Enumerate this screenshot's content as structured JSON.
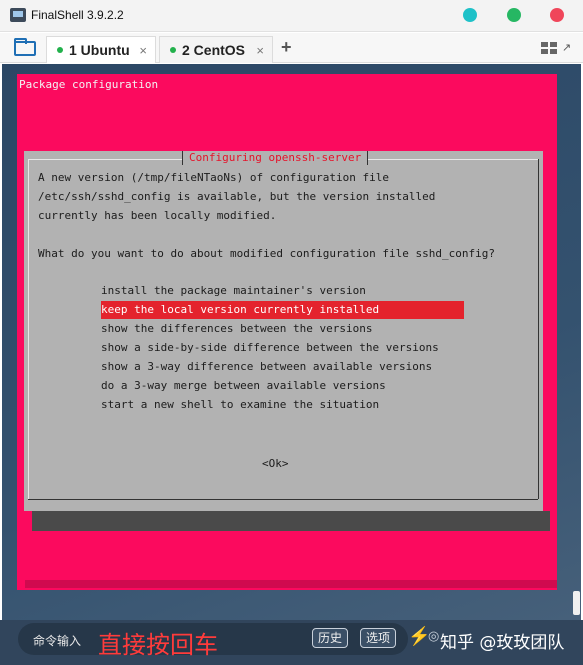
{
  "window": {
    "title": "FinalShell 3.9.2.2"
  },
  "tabs": [
    {
      "label": "1 Ubuntu",
      "close": "×"
    },
    {
      "label": "2 CentOS",
      "close": "×"
    }
  ],
  "tabbar": {
    "add": "+"
  },
  "terminal": {
    "header": "Package configuration",
    "dialog": {
      "title": "Configuring openssh-server",
      "message_lines": [
        "A new version (/tmp/fileNTaoNs) of configuration file",
        "/etc/ssh/sshd_config is available, but the version installed",
        "currently has been locally modified.",
        "What do you want to do about modified configuration file sshd_config?"
      ],
      "options": [
        "install the package maintainer's version",
        "keep the local version currently installed",
        "show the differences between the versions",
        "show a side-by-side difference between the versions",
        "show a 3-way difference between available versions",
        "do a 3-way merge between available versions",
        "start a new shell to examine the situation"
      ],
      "selected_index": 1,
      "ok_button": "<Ok>"
    }
  },
  "command_bar": {
    "label": "命令输入",
    "overlay_text": "直接按回车",
    "history_button": "历史",
    "options_button": "选项",
    "watermark": "知乎 @玫玫团队"
  },
  "colors": {
    "panel": "#fb0a5e",
    "dialog": "#b2b2b2",
    "selection": "#e4232d",
    "dialog_title": "#e5132a"
  }
}
